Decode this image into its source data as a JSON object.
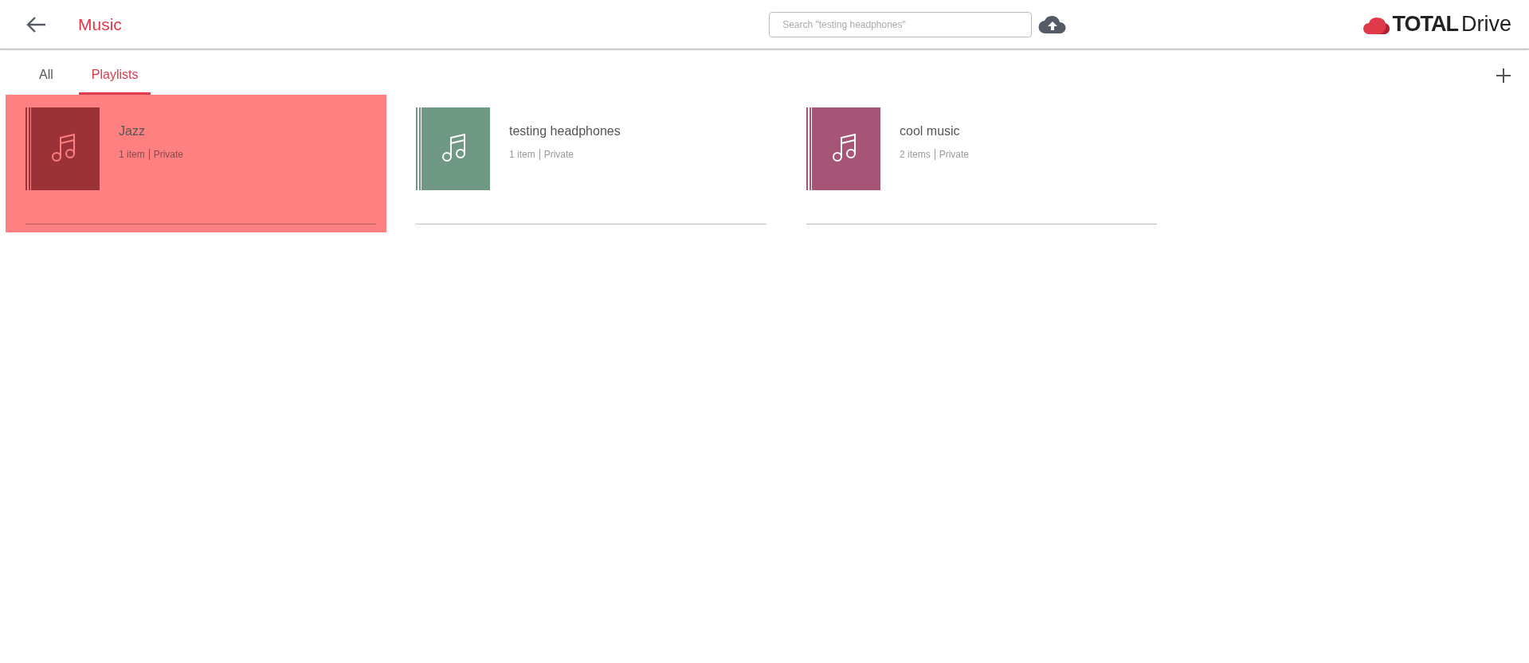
{
  "header": {
    "title": "Music",
    "search": {
      "placeholder": "Search \"testing headphones\""
    },
    "logo": {
      "bold": "TOTAL",
      "light": "Drive"
    }
  },
  "tabs": [
    {
      "label": "All",
      "selected": false
    },
    {
      "label": "Playlists",
      "selected": true
    }
  ],
  "playlists": [
    {
      "name": "Jazz",
      "count": "1 item",
      "privacy": "Private",
      "color": "#9b3237",
      "selected": true
    },
    {
      "name": "testing headphones",
      "count": "1 item",
      "privacy": "Private",
      "color": "#6f9985",
      "selected": false
    },
    {
      "name": "cool music",
      "count": "2 items",
      "privacy": "Private",
      "color": "#a65577",
      "selected": false
    }
  ]
}
